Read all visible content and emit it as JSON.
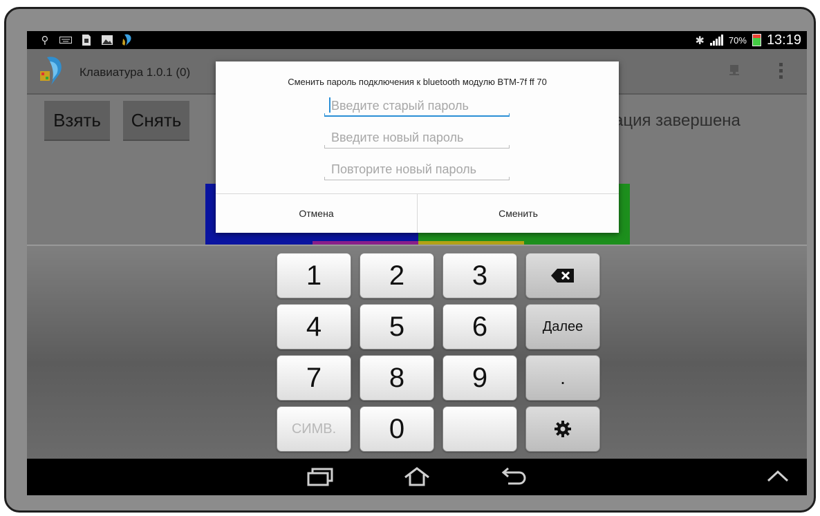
{
  "status_bar": {
    "left_icons": [
      "usb-icon",
      "keyboard-icon",
      "sim-card-icon",
      "image-icon",
      "app-notification-icon"
    ],
    "battery_percent": "70%",
    "time": "13:19"
  },
  "action_bar": {
    "title": "Клавиатура 1.0.1 (0)"
  },
  "content": {
    "take_label": "Взять",
    "remove_label": "Снять",
    "status_text": "ация завершена"
  },
  "dialog": {
    "title": "Сменить пароль подключения к bluetooth модулю BTM-7f ff 70",
    "old_password_placeholder": "Введите старый пароль",
    "new_password_placeholder": "Введите новый пароль",
    "repeat_password_placeholder": "Повторите новый пароль",
    "cancel_label": "Отмена",
    "change_label": "Сменить"
  },
  "keyboard": {
    "keys": {
      "k1": "1",
      "k2": "2",
      "k3": "3",
      "k4": "4",
      "k5": "5",
      "k6": "6",
      "k7": "7",
      "k8": "8",
      "k9": "9",
      "k0": "0",
      "next": "Далее",
      "dot": ".",
      "symbols": "СИМВ."
    }
  },
  "colors": {
    "accent": "#2a8fd6",
    "blue_bar": "#0a14a0",
    "green_bar": "#1d8f1d",
    "yellow_bar": "#b3a216",
    "purple_bar": "#8a1f8a"
  }
}
